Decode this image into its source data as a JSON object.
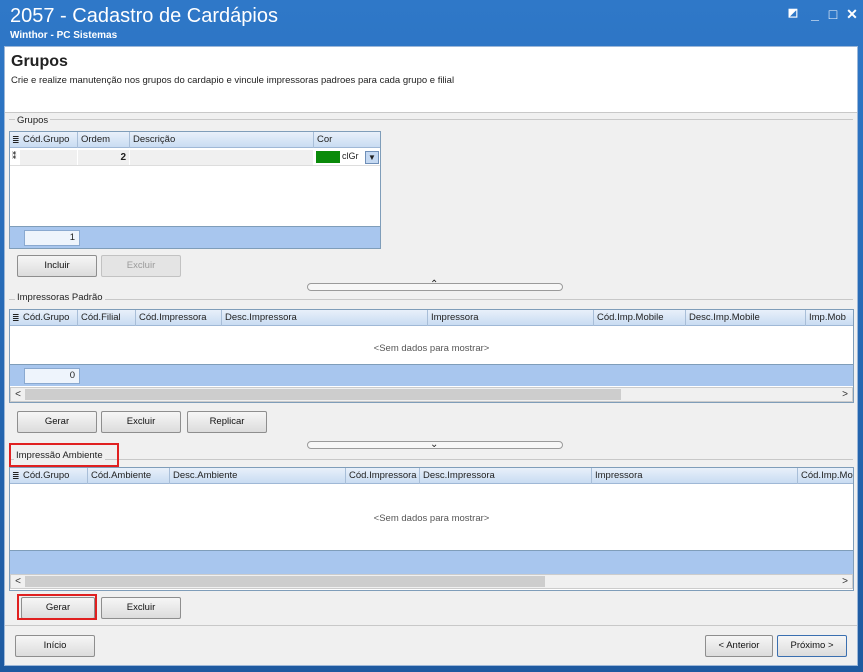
{
  "window": {
    "title": "2057 - Cadastro de Cardápios",
    "subtitle": "Winthor - PC Sistemas"
  },
  "header": {
    "title": "Grupos",
    "description": "Crie e realize manutenção nos grupos do cardapio e vincule impressoras padroes para cada grupo e filial"
  },
  "grupos": {
    "label": "Grupos",
    "columns": [
      "Cód.Grupo",
      "Ordem",
      "Descrição",
      "Cor"
    ],
    "row": {
      "ordem": "2",
      "cor": "clGr"
    },
    "count": "1",
    "buttons": {
      "incluir": "Incluir",
      "excluir": "Excluir"
    }
  },
  "impressoras": {
    "label": "Impressoras Padrão",
    "columns": [
      "Cód.Grupo",
      "Cód.Filial",
      "Cód.Impressora",
      "Desc.Impressora",
      "Impressora",
      "Cód.Imp.Mobile",
      "Desc.Imp.Mobile",
      "Imp.Mob"
    ],
    "nodata": "<Sem dados para mostrar>",
    "count": "0",
    "buttons": {
      "gerar": "Gerar",
      "excluir": "Excluir",
      "replicar": "Replicar"
    }
  },
  "ambiente": {
    "label": "Impressão  Ambiente",
    "columns": [
      "Cód.Grupo",
      "Cód.Ambiente",
      "Desc.Ambiente",
      "Cód.Impressora",
      "Desc.Impressora",
      "Impressora",
      "Cód.Imp.Mo"
    ],
    "nodata": "<Sem dados para mostrar>",
    "buttons": {
      "gerar": "Gerar",
      "excluir": "Excluir"
    }
  },
  "footer": {
    "inicio": "Início",
    "anterior": "< Anterior",
    "proximo": "Próximo >"
  },
  "colors": {
    "title_bar": "#2f78c8",
    "grid_footer": "#a8c6ee",
    "highlight": "#e02020",
    "cor_swatch": "#0a8a0a"
  }
}
